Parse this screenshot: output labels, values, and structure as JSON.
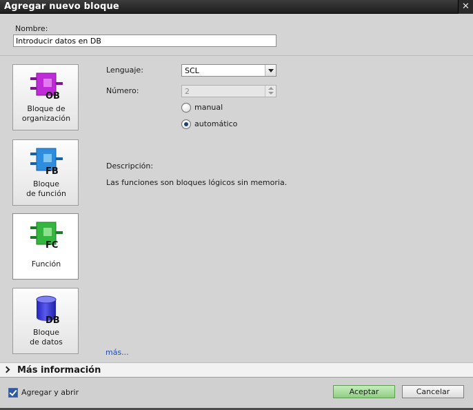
{
  "window": {
    "title": "Agregar nuevo bloque",
    "close_glyph": "✕"
  },
  "name_section": {
    "label": "Nombre:",
    "value": "Introducir datos en DB"
  },
  "block_types": [
    {
      "key": "OB",
      "badge": "OB",
      "label_line1": "Bloque de",
      "label_line2": "organización",
      "icon": "ob-block-icon",
      "color": "#c02bd8",
      "selected": false
    },
    {
      "key": "FB",
      "badge": "FB",
      "label_line1": "Bloque",
      "label_line2": "de función",
      "icon": "fb-block-icon",
      "color": "#2f8de0",
      "selected": false
    },
    {
      "key": "FC",
      "badge": "FC",
      "label_line1": "Función",
      "label_line2": "",
      "icon": "fc-block-icon",
      "color": "#35b640",
      "selected": true
    },
    {
      "key": "DB",
      "badge": "DB",
      "label_line1": "Bloque",
      "label_line2": "de datos",
      "icon": "db-cylinder-icon",
      "color": "#3a3ad6",
      "selected": false
    }
  ],
  "settings": {
    "language_label": "Lenguaje:",
    "language_value": "SCL",
    "number_label": "Número:",
    "number_value": "2",
    "radio_manual": "manual",
    "radio_auto": "automático",
    "selected_mode": "automático"
  },
  "description": {
    "title": "Descripción:",
    "text": "Las funciones son bloques lógicos sin memoria."
  },
  "more_link": "más...",
  "info_bar": {
    "label": "Más información"
  },
  "footer": {
    "checkbox_label": "Agregar y abrir",
    "checkbox_checked": true,
    "ok_label": "Aceptar",
    "cancel_label": "Cancelar"
  },
  "colors": {
    "accent_ok": "#8fce82",
    "link": "#1e4fb4",
    "titlebar": "#2a2a2a"
  }
}
